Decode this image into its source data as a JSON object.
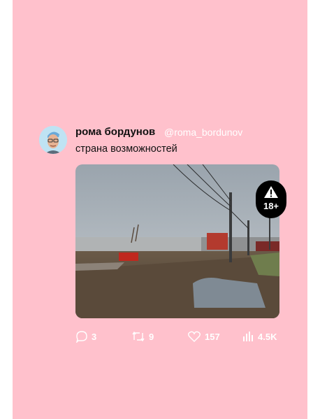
{
  "post": {
    "author_name": "рома бордунов",
    "author_handle": "@roma_bordunov",
    "text": "страна возможностей",
    "media_badge": "18+"
  },
  "metrics": {
    "replies": "3",
    "reposts": "9",
    "likes": "157",
    "views": "4.5K"
  },
  "colors": {
    "background": "#ffc1cc",
    "metric_text": "#ffffff"
  }
}
